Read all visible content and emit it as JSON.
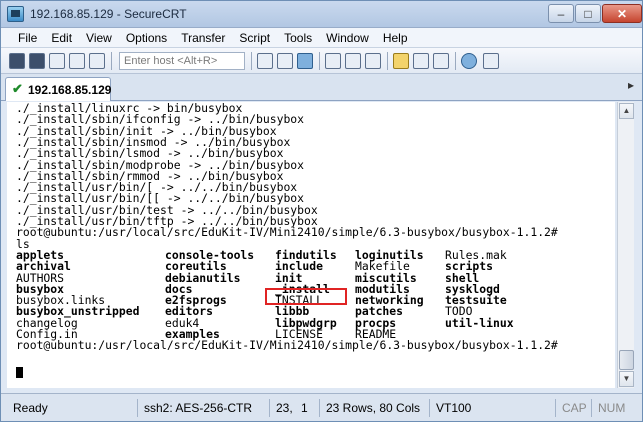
{
  "window": {
    "title": "192.168.85.129 - SecureCRT"
  },
  "titlebar_buttons": {
    "minimize": "–",
    "maximize": "□",
    "close": "✕"
  },
  "menu": [
    "File",
    "Edit",
    "View",
    "Options",
    "Transfer",
    "Script",
    "Tools",
    "Window",
    "Help"
  ],
  "toolbar": {
    "host_placeholder": "Enter host <Alt+R>"
  },
  "tab": {
    "label": "192.168.85.129",
    "arrow": "▸"
  },
  "terminal": {
    "lines": [
      "./_install/linuxrc -> bin/busybox",
      "./_install/sbin/ifconfig -> ../bin/busybox",
      "./_install/sbin/init -> ../bin/busybox",
      "./_install/sbin/insmod -> ../bin/busybox",
      "./_install/sbin/lsmod -> ../bin/busybox",
      "./_install/sbin/modprobe -> ../bin/busybox",
      "./_install/sbin/rmmod -> ../bin/busybox",
      "./_install/usr/bin/[ -> ../../bin/busybox",
      "./_install/usr/bin/[[ -> ../../bin/busybox",
      "./_install/usr/bin/test -> ../../bin/busybox",
      "./_install/usr/bin/tftp -> ../../bin/busybox"
    ],
    "prompt": "root@ubuntu:/usr/local/src/EduKit-IV/Mini2410/simple/6.3-busybox/busybox-1.1.2#",
    "command": "ls",
    "ls_rows": [
      [
        "applets",
        "console-tools",
        "findutils",
        "loginutils",
        "Rules.mak"
      ],
      [
        "archival",
        "coreutils",
        "include",
        "Makefile",
        "scripts"
      ],
      [
        "AUTHORS",
        "debianutils",
        "init",
        "miscutils",
        "shell"
      ],
      [
        "busybox",
        "docs",
        "_install",
        "modutils",
        "sysklogd"
      ],
      [
        "busybox.links",
        "e2fsprogs",
        "INSTALL",
        "networking",
        "testsuite"
      ],
      [
        "busybox_unstripped",
        "editors",
        "libbb",
        "patches",
        "TODO"
      ],
      [
        "changelog",
        "eduk4",
        "libpwdgrp",
        "procps",
        "util-linux"
      ],
      [
        "Config.in",
        "examples",
        "LICENSE",
        "README",
        ""
      ]
    ],
    "ls_bold": [
      [
        true,
        true,
        true,
        true,
        false
      ],
      [
        true,
        true,
        true,
        false,
        true
      ],
      [
        false,
        true,
        true,
        true,
        true
      ],
      [
        true,
        true,
        true,
        true,
        true
      ],
      [
        false,
        true,
        false,
        true,
        true
      ],
      [
        true,
        true,
        true,
        true,
        false
      ],
      [
        false,
        false,
        true,
        true,
        true
      ],
      [
        false,
        true,
        false,
        false,
        false
      ]
    ],
    "prompt_final": "root@ubuntu:/usr/local/src/EduKit-IV/Mini2410/simple/6.3-busybox/busybox-1.1.2#"
  },
  "scrollbar": {
    "up": "▲",
    "down": "▼"
  },
  "status": {
    "state": "Ready",
    "cipher": "ssh2: AES-256-CTR",
    "row": "23,",
    "col": "1",
    "size": "23 Rows, 80 Cols",
    "emulation": "VT100",
    "caps": "CAP",
    "num": "NUM"
  },
  "colors": {
    "highlight_box": "#e02424",
    "tab_check": "#1e8a2a"
  }
}
